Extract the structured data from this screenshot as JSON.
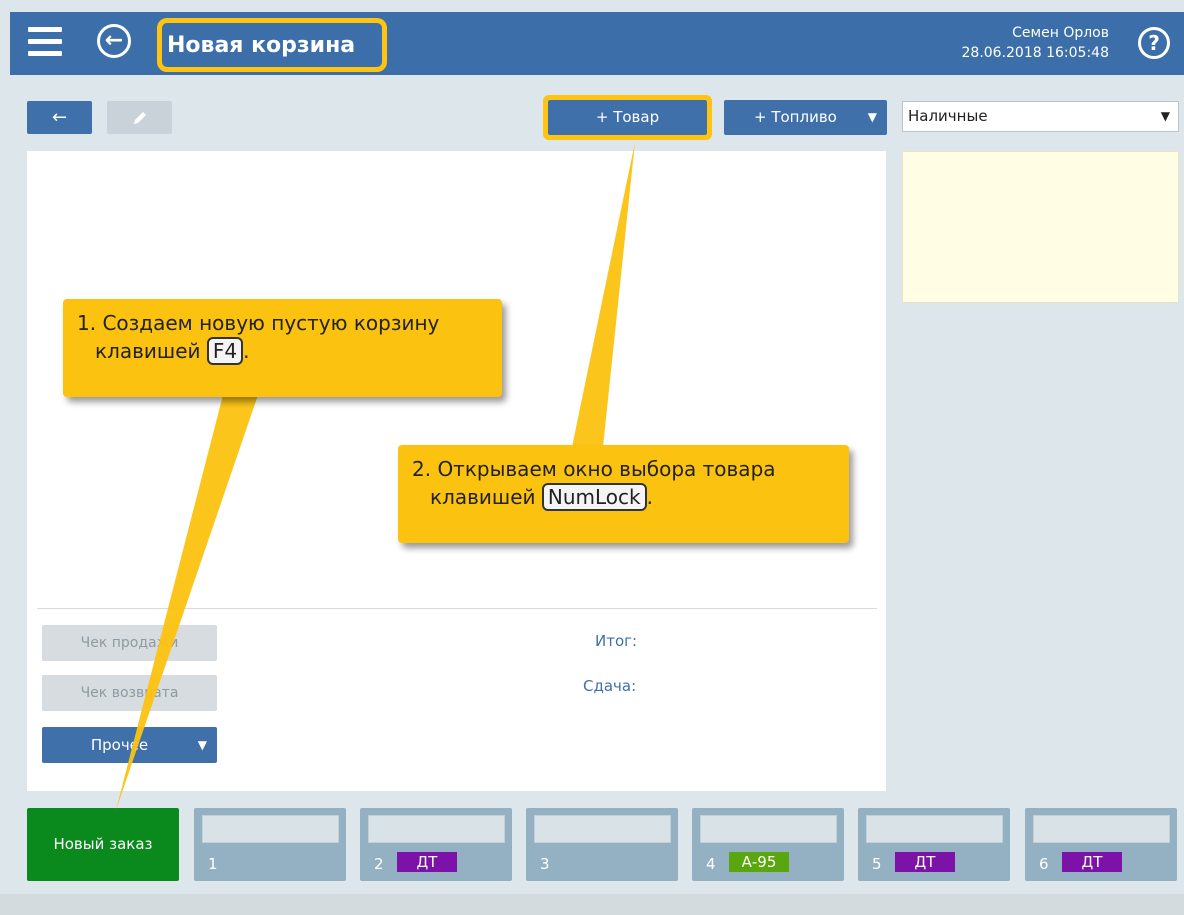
{
  "header": {
    "title": "Новая корзина",
    "user_name": "Семен Орлов",
    "datetime": "28.06.2018 16:05:48",
    "help_glyph": "?",
    "back_glyph": "←"
  },
  "toolbar": {
    "back_label": "←",
    "add_product_label": "+ Товар",
    "add_fuel_label": "+ Топливо",
    "dropdown_glyph": "▼",
    "payment_selected": "Наличные"
  },
  "cart": {
    "sale_receipt_label": "Чек продажи",
    "return_receipt_label": "Чек возврата",
    "more_label": "Прочее",
    "total_label": "Итог:",
    "change_label": "Сдача:"
  },
  "tabs": {
    "new_order_label": "Новый заказ",
    "items": [
      {
        "number": "1",
        "badge": ""
      },
      {
        "number": "2",
        "badge": "ДТ"
      },
      {
        "number": "3",
        "badge": ""
      },
      {
        "number": "4",
        "badge": "А-95"
      },
      {
        "number": "5",
        "badge": "ДТ"
      },
      {
        "number": "6",
        "badge": "ДТ"
      }
    ]
  },
  "callouts": {
    "step1_text_a": "1. Создаем новую пустую корзину",
    "step1_text_b": "клавишей",
    "step1_key": "F4",
    "step1_tail": ".",
    "step2_text_a": "2. Открываем окно выбора товара",
    "step2_text_b": "клавишей",
    "step2_key": "NumLock",
    "step2_tail": "."
  },
  "colors": {
    "header": "#3c6fa9",
    "accent_blue": "#3f70aa",
    "highlight": "#ffc310",
    "new_order_green": "#0a8a1c",
    "badge_dt": "#7d12a8",
    "badge_a95": "#5aa60e",
    "note_yellow": "#fffde3"
  },
  "icons": {
    "menu": "hamburger-icon",
    "back": "back-circle-icon",
    "help": "help-circle-icon",
    "edit": "pencil-icon"
  }
}
